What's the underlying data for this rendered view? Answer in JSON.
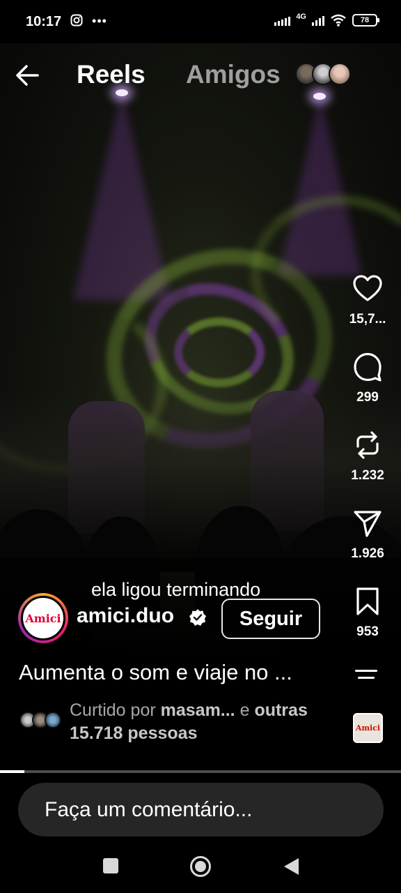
{
  "status_bar": {
    "time": "10:17",
    "network": "4G",
    "battery": "78",
    "left_icons": [
      "instagram-icon",
      "more-dots-icon"
    ]
  },
  "header": {
    "tabs": [
      {
        "label": "Reels",
        "active": true
      },
      {
        "label": "Amigos",
        "active": false
      }
    ]
  },
  "actions": {
    "like_count": "15,7...",
    "comment_count": "299",
    "repost_count": "1.232",
    "share_count": "1.926",
    "save_count": "953"
  },
  "reel": {
    "song_overlay": "ela ligou terminando",
    "username": "amici.duo",
    "follow_label": "Seguir",
    "caption": "Aumenta o som e viaje no ...",
    "liked_by_prefix": "Curtido por ",
    "liked_by_user": "masam...",
    "liked_by_mid": " e ",
    "liked_by_others": "outras",
    "liked_by_count": "15.718 pessoas",
    "avatar_text": "Amici",
    "music_thumb_text": "Amici"
  },
  "progress": 0.06,
  "comment": {
    "placeholder": "Faça um comentário..."
  },
  "colors": {
    "accent_purple": "#9646c8",
    "laser_green": "#8fc43a",
    "input_bg": "#262626"
  }
}
